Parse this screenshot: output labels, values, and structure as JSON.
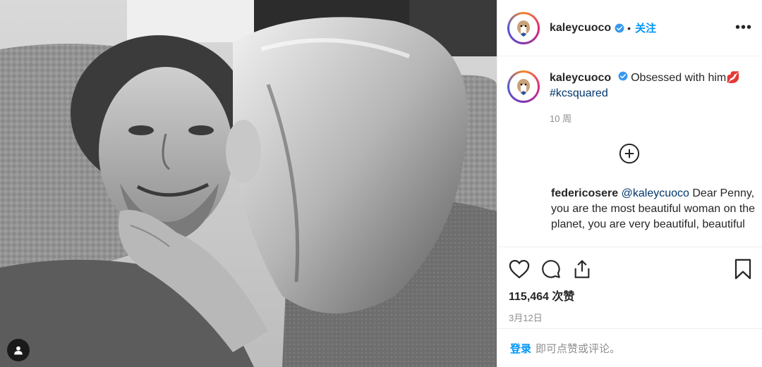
{
  "post": {
    "username": "kaleycuoco",
    "follow_label": "关注",
    "more_label": "•••",
    "dot": "•",
    "caption_text": "Obsessed with him💋",
    "hashtag": "#kcsquared",
    "time_ago": "10 周",
    "comment": {
      "username": "federicosere",
      "mention": "@kaleycuoco",
      "text": "Dear Penny, you are the most beautiful woman on the planet, you are very beautiful, beautiful and very sexy ❤️"
    },
    "likes": "115,464 次赞",
    "date": "3月12日",
    "login_link": "登录",
    "login_rest": "即可点赞或评论。"
  },
  "icons": {
    "verified": "verified-badge-icon",
    "like": "heart-icon",
    "comment": "comment-icon",
    "share": "share-icon",
    "save": "bookmark-icon",
    "load_more": "plus-circle-icon",
    "user_tag": "user-tag-icon"
  },
  "colors": {
    "accent": "#0095f6",
    "verified": "#3897f0",
    "text": "#262626",
    "muted": "#8e8e8e"
  }
}
